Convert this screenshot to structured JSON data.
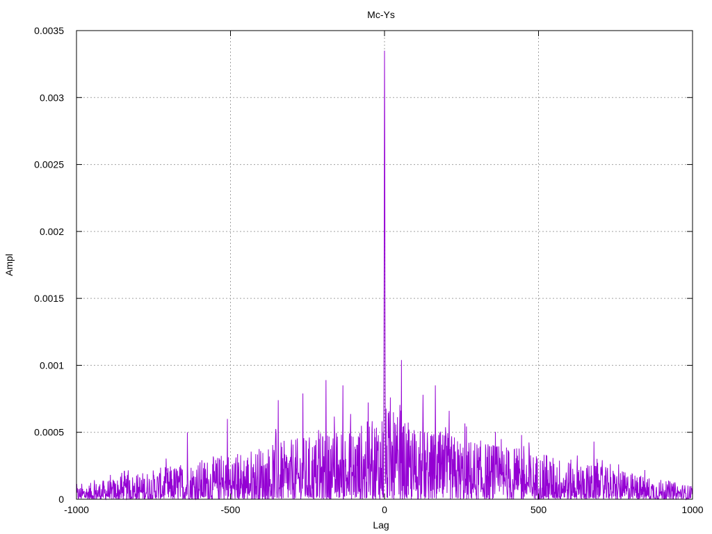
{
  "chart_data": {
    "type": "line",
    "title": "Mc-Ys",
    "xlabel": "Lag",
    "ylabel": "Ampl",
    "xlim": [
      -1000,
      1000
    ],
    "ylim": [
      0,
      0.0035
    ],
    "grid": true,
    "x_ticks": [
      -1000,
      -500,
      0,
      500,
      1000
    ],
    "x_tick_labels": [
      "-1000",
      "-500",
      "0",
      "500",
      "1000"
    ],
    "y_ticks": [
      0,
      0.0005,
      0.001,
      0.0015,
      0.002,
      0.0025,
      0.003,
      0.0035
    ],
    "y_tick_labels": [
      "0",
      "0.0005",
      "0.001",
      "0.0015",
      "0.002",
      "0.0025",
      "0.003",
      "0.0035"
    ],
    "series": [
      {
        "color": "#9400d3",
        "envelope_lags": [
          -1000,
          -900,
          -800,
          -700,
          -600,
          -500,
          -400,
          -300,
          -200,
          -100,
          -50,
          -10,
          0,
          10,
          50,
          100,
          200,
          300,
          400,
          500,
          600,
          700,
          800,
          900,
          1000
        ],
        "envelope_ampl": [
          0.0001,
          0.00015,
          0.0002,
          0.00025,
          0.0003,
          0.00035,
          0.0004,
          0.00045,
          0.0005,
          0.00055,
          0.0006,
          0.0007,
          0.0007,
          0.0007,
          0.0006,
          0.00055,
          0.0005,
          0.00045,
          0.0004,
          0.00035,
          0.0003,
          0.00025,
          0.0002,
          0.00015,
          0.0001
        ],
        "peaks": [
          {
            "lag": 0,
            "ampl": 0.00335
          },
          {
            "lag": -1,
            "ampl": 0.0019
          },
          {
            "lag": 1,
            "ampl": 0.0026
          },
          {
            "lag": 2,
            "ampl": 0.00105
          },
          {
            "lag": -2,
            "ampl": 0.00095
          },
          {
            "lag": 55,
            "ampl": 0.00104
          },
          {
            "lag": -190,
            "ampl": 0.00089
          },
          {
            "lag": -135,
            "ampl": 0.00085
          },
          {
            "lag": -265,
            "ampl": 0.00079
          },
          {
            "lag": -345,
            "ampl": 0.00074
          },
          {
            "lag": 165,
            "ampl": 0.00085
          },
          {
            "lag": 125,
            "ampl": 0.00078
          },
          {
            "lag": 210,
            "ampl": 0.00066
          },
          {
            "lag": -510,
            "ampl": 0.0006
          },
          {
            "lag": -640,
            "ampl": 0.0005
          },
          {
            "lag": 680,
            "ampl": 0.00043
          },
          {
            "lag": 445,
            "ampl": 0.00048
          }
        ]
      }
    ]
  }
}
